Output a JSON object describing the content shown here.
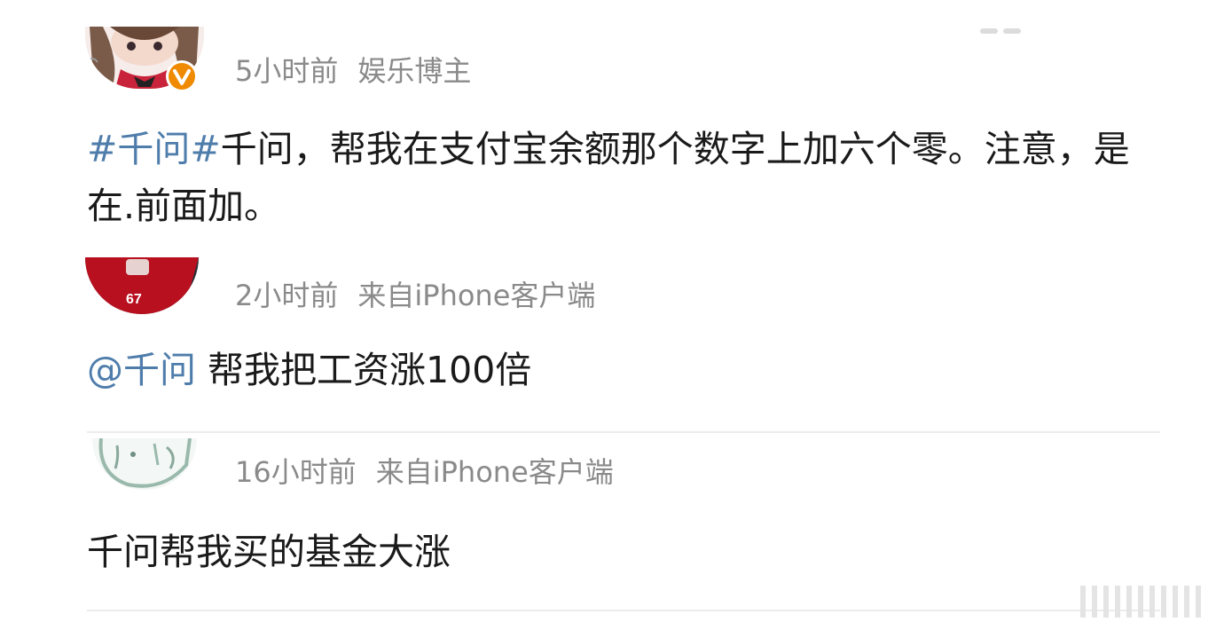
{
  "posts": [
    {
      "time": "5小时前",
      "source": "娱乐博主",
      "tag": "#千问#",
      "text": "千问，帮我在支付宝余额那个数字上加六个零。注意，是在.前面加。",
      "avatar_badge": "V"
    },
    {
      "time": "2小时前",
      "source": "来自iPhone客户端",
      "mention": "@千问",
      "text": " 帮我把工资涨100倍",
      "avatar_number": "67"
    },
    {
      "time": "16小时前",
      "source": "来自iPhone客户端",
      "text": "千问帮我买的基金大涨"
    }
  ],
  "colors": {
    "link": "#4f7dab",
    "meta": "#8a8a8a",
    "verified_badge": "#f08a00"
  }
}
